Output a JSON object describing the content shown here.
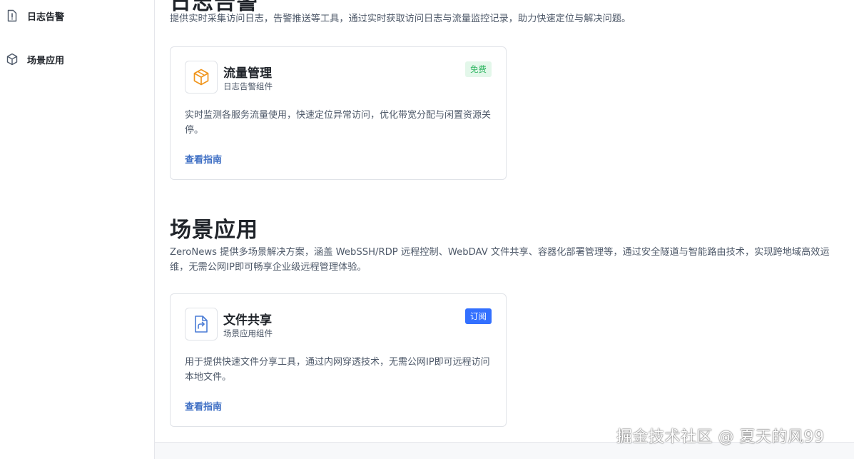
{
  "sidebar": {
    "items": [
      {
        "label": "日志告警",
        "icon": "alert-doc-icon"
      },
      {
        "label": "场景应用",
        "icon": "cube-icon"
      }
    ]
  },
  "sections": [
    {
      "title": "日志告警",
      "description": "提供实时采集访问日志，告警推送等工具，通过实时获取访问日志与流量监控记录，助力快速定位与解决问题。",
      "card": {
        "icon": "box-icon",
        "title": "流量管理",
        "subtitle": "日志告警组件",
        "badge": "免费",
        "description": "实时监测各服务流量使用，快速定位异常访问，优化带宽分配与闲置资源关停。",
        "link": "查看指南"
      }
    },
    {
      "title": "场景应用",
      "description": "ZeroNews 提供多场景解决方案，涵盖 WebSSH/RDP 远程控制、WebDAV 文件共享、容器化部署管理等，通过安全隧道与智能路由技术，实现跨地域高效运维，无需公网IP即可畅享企业级远程管理体验。",
      "card": {
        "icon": "file-share-icon",
        "title": "文件共享",
        "subtitle": "场景应用组件",
        "badge": "订阅",
        "description": "用于提供快速文件分享工具，通过内网穿透技术，无需公网IP即可远程访问本地文件。",
        "link": "查看指南"
      }
    }
  ],
  "watermark": "掘金技术社区 @ 夏天的风99",
  "colors": {
    "accent": "#3370ff",
    "link": "#3f6fc4",
    "free_badge_bg": "#e3f7ea",
    "free_badge_text": "#2fb561",
    "icon_orange": "#f0961e",
    "icon_blue": "#4a7cd6"
  }
}
